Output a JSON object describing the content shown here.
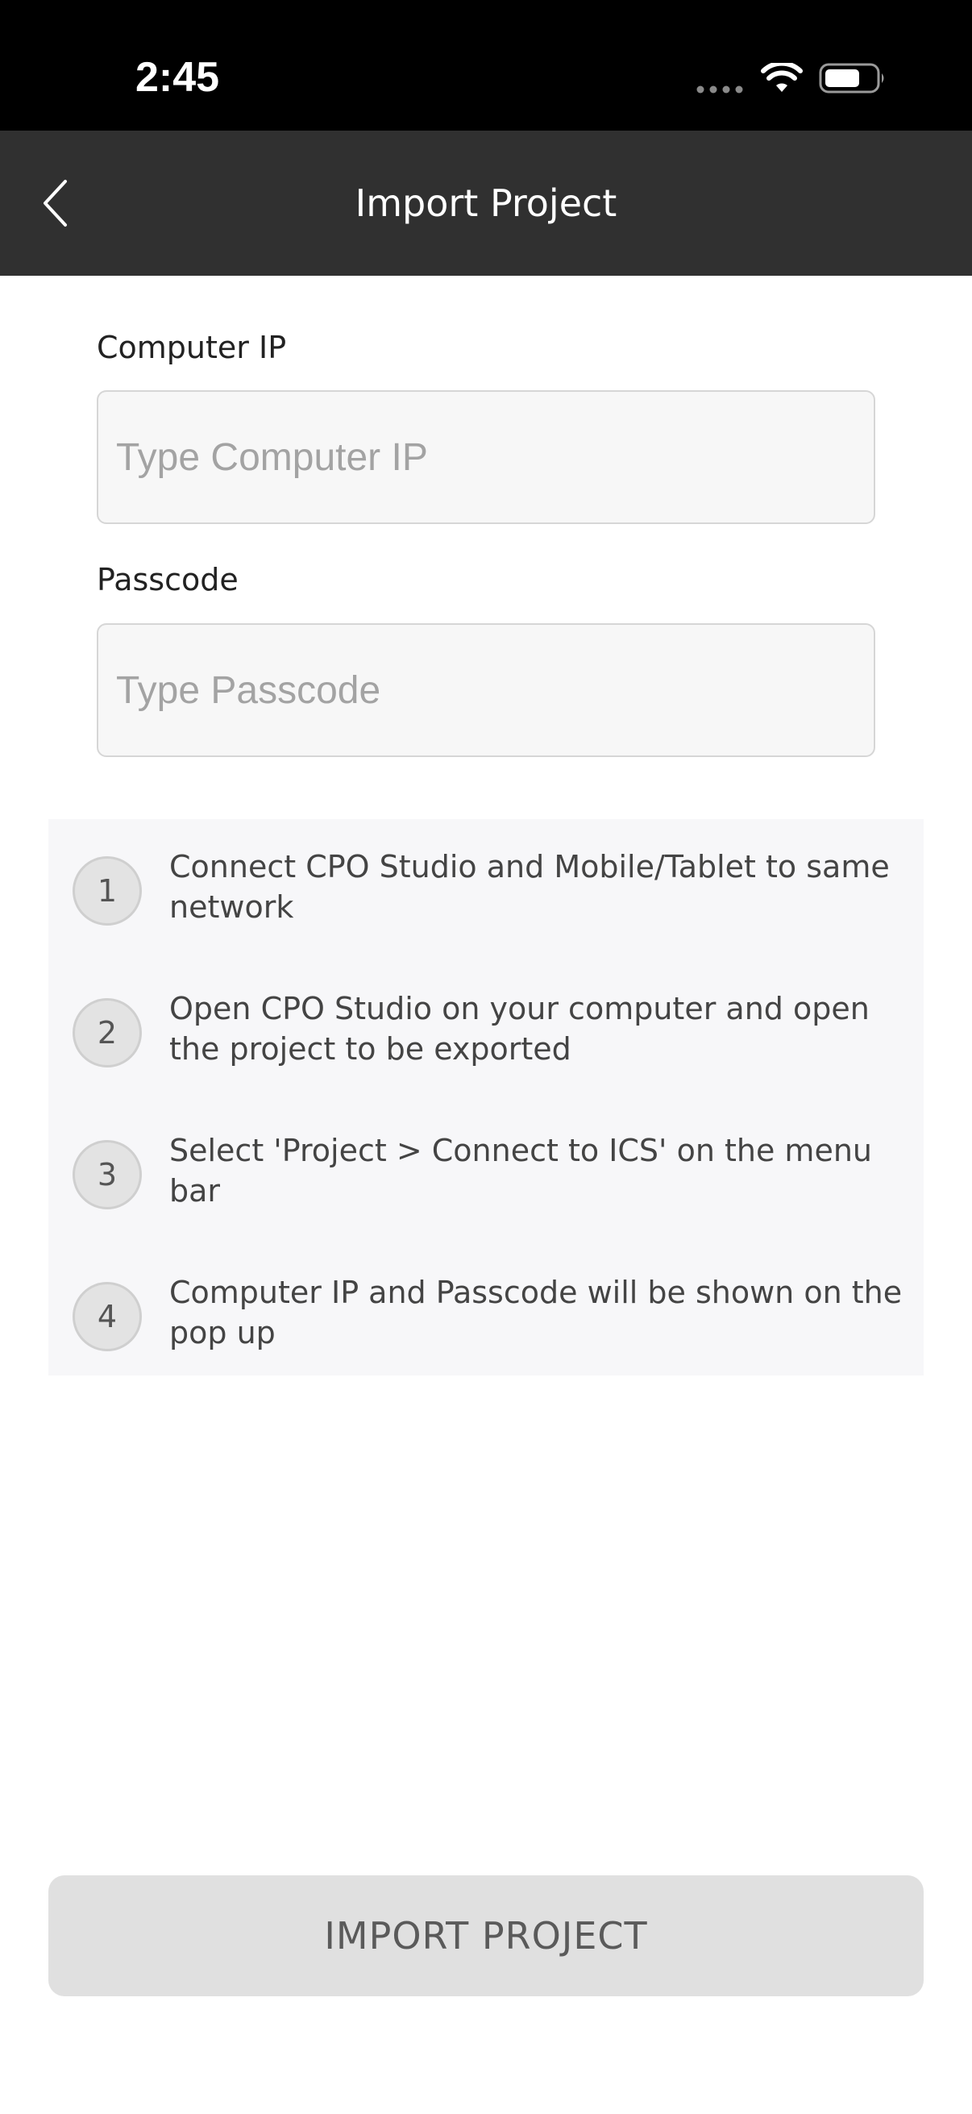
{
  "status_bar": {
    "time": "2:45"
  },
  "nav": {
    "title": "Import Project",
    "back_icon": "chevron-left-icon"
  },
  "form": {
    "computer_ip": {
      "label": "Computer IP",
      "value": "",
      "placeholder": "Type Computer IP"
    },
    "passcode": {
      "label": "Passcode",
      "value": "",
      "placeholder": "Type Passcode"
    }
  },
  "instructions": [
    {
      "number": "1",
      "text": "Connect CPO Studio and Mobile/Tablet to same network"
    },
    {
      "number": "2",
      "text": "Open CPO Studio on your computer and open the project to be exported"
    },
    {
      "number": "3",
      "text": "Select 'Project > Connect to ICS' on the menu bar"
    },
    {
      "number": "4",
      "text": "Computer IP and Passcode will be shown on the pop up"
    }
  ],
  "import_button": {
    "label": "IMPORT PROJECT"
  },
  "colors": {
    "status_bar_bg": "#000000",
    "nav_bg": "#303030",
    "input_bg": "#f7f7f7",
    "instructions_bg": "#f7f7f9",
    "button_bg": "#e0e0e0",
    "button_text": "#5a5a5a"
  }
}
